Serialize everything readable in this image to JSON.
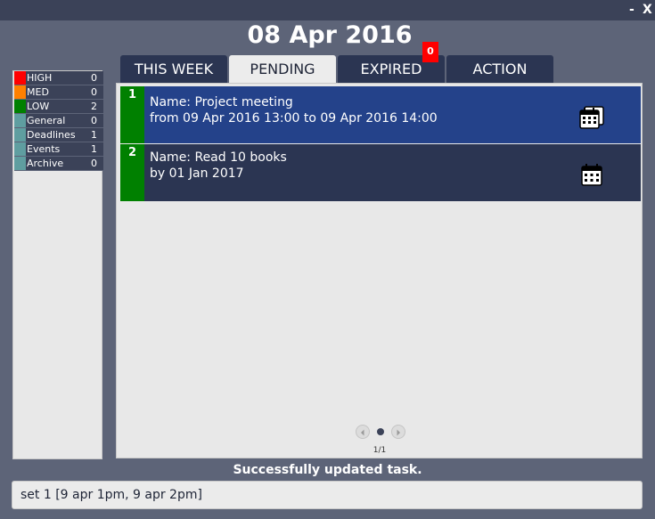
{
  "window": {
    "minimize_label": "-",
    "close_label": "X"
  },
  "header": {
    "date": "08 Apr 2016"
  },
  "sidebar": {
    "categories": [
      {
        "label": "HIGH",
        "count": "0",
        "color": "#ff0000"
      },
      {
        "label": "MED",
        "count": "0",
        "color": "#ff8000"
      },
      {
        "label": "LOW",
        "count": "2",
        "color": "#008000"
      },
      {
        "label": "General",
        "count": "0",
        "color": "#5f9ea0"
      },
      {
        "label": "Deadlines",
        "count": "1",
        "color": "#5f9ea0"
      },
      {
        "label": "Events",
        "count": "1",
        "color": "#5f9ea0"
      },
      {
        "label": "Archive",
        "count": "0",
        "color": "#5f9ea0"
      }
    ]
  },
  "tabs": [
    {
      "label": "THIS WEEK",
      "active": false
    },
    {
      "label": "PENDING",
      "active": true
    },
    {
      "label": "EXPIRED",
      "active": false
    },
    {
      "label": "ACTION",
      "active": false
    }
  ],
  "expired_badge": "0",
  "tasks": [
    {
      "number": "1",
      "line1": "Name: Project meeting",
      "line2": "from 09 Apr 2016 13:00 to 09 Apr 2016 14:00",
      "icon": "calendar-range-icon",
      "selected": true
    },
    {
      "number": "2",
      "line1": "Name: Read 10 books",
      "line2": "by 01 Jan 2017",
      "icon": "calendar-icon",
      "selected": false
    }
  ],
  "pagination": {
    "label": "1/1"
  },
  "status": "Successfully updated task.",
  "command_input": {
    "value": "set 1 [9 apr 1pm, 9 apr 2pm]"
  }
}
